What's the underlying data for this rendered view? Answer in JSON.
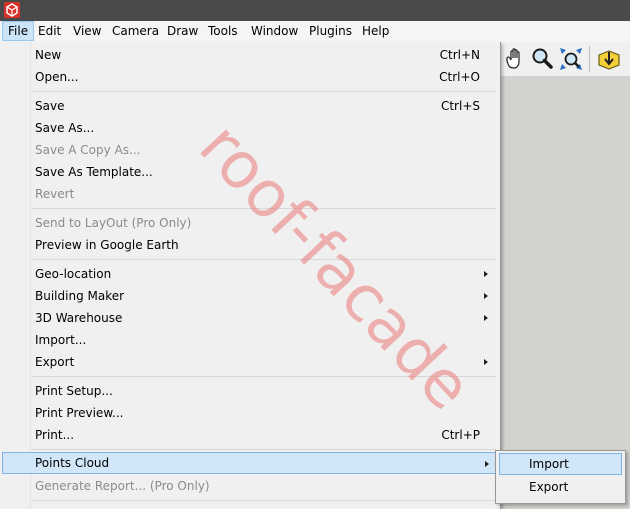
{
  "menubar": {
    "items": [
      "File",
      "Edit",
      "View",
      "Camera",
      "Draw",
      "Tools",
      "Window",
      "Plugins",
      "Help"
    ],
    "active": "File"
  },
  "toolbar": {
    "icons": [
      "pan-icon",
      "zoom-icon",
      "zoom-extents-icon",
      "get-models-icon"
    ]
  },
  "file_menu": {
    "new": {
      "label": "New",
      "shortcut": "Ctrl+N"
    },
    "open": {
      "label": "Open...",
      "shortcut": "Ctrl+O"
    },
    "save": {
      "label": "Save",
      "shortcut": "Ctrl+S"
    },
    "save_as": {
      "label": "Save As..."
    },
    "save_copy_as": {
      "label": "Save A Copy As..."
    },
    "save_as_template": {
      "label": "Save As Template..."
    },
    "revert": {
      "label": "Revert"
    },
    "send_to_layout": {
      "label": "Send to LayOut (Pro Only)"
    },
    "preview_google_earth": {
      "label": "Preview in Google Earth"
    },
    "geo_location": {
      "label": "Geo-location"
    },
    "building_maker": {
      "label": "Building Maker"
    },
    "warehouse": {
      "label": "3D Warehouse"
    },
    "import": {
      "label": "Import..."
    },
    "export": {
      "label": "Export"
    },
    "print_setup": {
      "label": "Print Setup..."
    },
    "print_preview": {
      "label": "Print Preview..."
    },
    "print": {
      "label": "Print...",
      "shortcut": "Ctrl+P"
    },
    "points_cloud": {
      "label": "Points Cloud"
    },
    "generate_report": {
      "label": "Generate Report... (Pro Only)"
    }
  },
  "points_cloud_submenu": {
    "import": "Import",
    "export": "Export"
  },
  "watermark": "roof-facade",
  "colors": {
    "highlight": "#d1e6f9",
    "highlight_border": "#7fb4e5",
    "disabled_text": "#8b8b8b",
    "watermark": "#eb7878"
  }
}
